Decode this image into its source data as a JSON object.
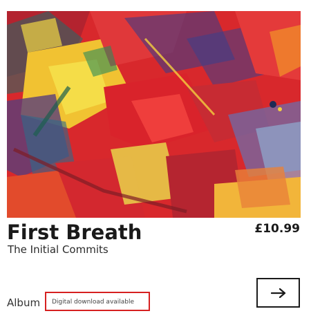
{
  "product": {
    "title": "First Breath",
    "artist": "The Initial Commits",
    "price": "£10.99",
    "format": "Album",
    "availability": "Digital download available"
  },
  "icons": {
    "action": "arrow-right-icon"
  },
  "colors": {
    "highlight_border": "#d62020",
    "text": "#1a1a1a"
  }
}
